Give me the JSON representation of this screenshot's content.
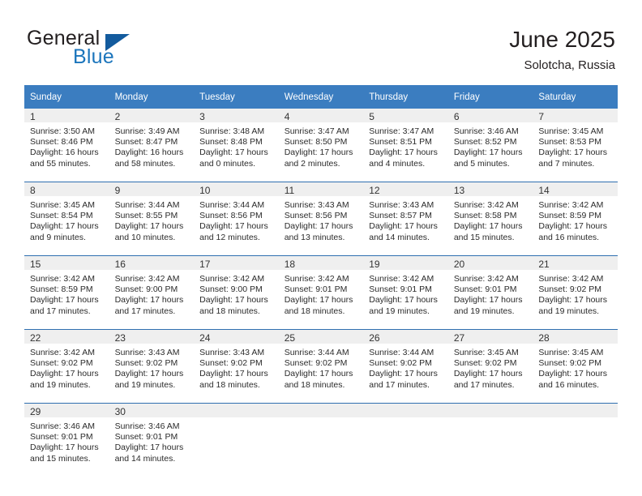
{
  "brand": {
    "name_part1": "General",
    "name_part2": "Blue",
    "triangle_icon": "triangle-logo-icon",
    "color_dark": "#231f20",
    "color_blue": "#1b75bc"
  },
  "header": {
    "title": "June 2025",
    "subtitle": "Solotcha, Russia"
  },
  "theme": {
    "header_bg": "#3b7dc0",
    "daynum_bg": "#efefef",
    "row_divider": "#2f6fb0"
  },
  "weekday_headers": [
    "Sunday",
    "Monday",
    "Tuesday",
    "Wednesday",
    "Thursday",
    "Friday",
    "Saturday"
  ],
  "weeks": [
    {
      "days": [
        {
          "num": "1",
          "sunrise": "Sunrise: 3:50 AM",
          "sunset": "Sunset: 8:46 PM",
          "daylight1": "Daylight: 16 hours",
          "daylight2": "and 55 minutes."
        },
        {
          "num": "2",
          "sunrise": "Sunrise: 3:49 AM",
          "sunset": "Sunset: 8:47 PM",
          "daylight1": "Daylight: 16 hours",
          "daylight2": "and 58 minutes."
        },
        {
          "num": "3",
          "sunrise": "Sunrise: 3:48 AM",
          "sunset": "Sunset: 8:48 PM",
          "daylight1": "Daylight: 17 hours",
          "daylight2": "and 0 minutes."
        },
        {
          "num": "4",
          "sunrise": "Sunrise: 3:47 AM",
          "sunset": "Sunset: 8:50 PM",
          "daylight1": "Daylight: 17 hours",
          "daylight2": "and 2 minutes."
        },
        {
          "num": "5",
          "sunrise": "Sunrise: 3:47 AM",
          "sunset": "Sunset: 8:51 PM",
          "daylight1": "Daylight: 17 hours",
          "daylight2": "and 4 minutes."
        },
        {
          "num": "6",
          "sunrise": "Sunrise: 3:46 AM",
          "sunset": "Sunset: 8:52 PM",
          "daylight1": "Daylight: 17 hours",
          "daylight2": "and 5 minutes."
        },
        {
          "num": "7",
          "sunrise": "Sunrise: 3:45 AM",
          "sunset": "Sunset: 8:53 PM",
          "daylight1": "Daylight: 17 hours",
          "daylight2": "and 7 minutes."
        }
      ]
    },
    {
      "days": [
        {
          "num": "8",
          "sunrise": "Sunrise: 3:45 AM",
          "sunset": "Sunset: 8:54 PM",
          "daylight1": "Daylight: 17 hours",
          "daylight2": "and 9 minutes."
        },
        {
          "num": "9",
          "sunrise": "Sunrise: 3:44 AM",
          "sunset": "Sunset: 8:55 PM",
          "daylight1": "Daylight: 17 hours",
          "daylight2": "and 10 minutes."
        },
        {
          "num": "10",
          "sunrise": "Sunrise: 3:44 AM",
          "sunset": "Sunset: 8:56 PM",
          "daylight1": "Daylight: 17 hours",
          "daylight2": "and 12 minutes."
        },
        {
          "num": "11",
          "sunrise": "Sunrise: 3:43 AM",
          "sunset": "Sunset: 8:56 PM",
          "daylight1": "Daylight: 17 hours",
          "daylight2": "and 13 minutes."
        },
        {
          "num": "12",
          "sunrise": "Sunrise: 3:43 AM",
          "sunset": "Sunset: 8:57 PM",
          "daylight1": "Daylight: 17 hours",
          "daylight2": "and 14 minutes."
        },
        {
          "num": "13",
          "sunrise": "Sunrise: 3:42 AM",
          "sunset": "Sunset: 8:58 PM",
          "daylight1": "Daylight: 17 hours",
          "daylight2": "and 15 minutes."
        },
        {
          "num": "14",
          "sunrise": "Sunrise: 3:42 AM",
          "sunset": "Sunset: 8:59 PM",
          "daylight1": "Daylight: 17 hours",
          "daylight2": "and 16 minutes."
        }
      ]
    },
    {
      "days": [
        {
          "num": "15",
          "sunrise": "Sunrise: 3:42 AM",
          "sunset": "Sunset: 8:59 PM",
          "daylight1": "Daylight: 17 hours",
          "daylight2": "and 17 minutes."
        },
        {
          "num": "16",
          "sunrise": "Sunrise: 3:42 AM",
          "sunset": "Sunset: 9:00 PM",
          "daylight1": "Daylight: 17 hours",
          "daylight2": "and 17 minutes."
        },
        {
          "num": "17",
          "sunrise": "Sunrise: 3:42 AM",
          "sunset": "Sunset: 9:00 PM",
          "daylight1": "Daylight: 17 hours",
          "daylight2": "and 18 minutes."
        },
        {
          "num": "18",
          "sunrise": "Sunrise: 3:42 AM",
          "sunset": "Sunset: 9:01 PM",
          "daylight1": "Daylight: 17 hours",
          "daylight2": "and 18 minutes."
        },
        {
          "num": "19",
          "sunrise": "Sunrise: 3:42 AM",
          "sunset": "Sunset: 9:01 PM",
          "daylight1": "Daylight: 17 hours",
          "daylight2": "and 19 minutes."
        },
        {
          "num": "20",
          "sunrise": "Sunrise: 3:42 AM",
          "sunset": "Sunset: 9:01 PM",
          "daylight1": "Daylight: 17 hours",
          "daylight2": "and 19 minutes."
        },
        {
          "num": "21",
          "sunrise": "Sunrise: 3:42 AM",
          "sunset": "Sunset: 9:02 PM",
          "daylight1": "Daylight: 17 hours",
          "daylight2": "and 19 minutes."
        }
      ]
    },
    {
      "days": [
        {
          "num": "22",
          "sunrise": "Sunrise: 3:42 AM",
          "sunset": "Sunset: 9:02 PM",
          "daylight1": "Daylight: 17 hours",
          "daylight2": "and 19 minutes."
        },
        {
          "num": "23",
          "sunrise": "Sunrise: 3:43 AM",
          "sunset": "Sunset: 9:02 PM",
          "daylight1": "Daylight: 17 hours",
          "daylight2": "and 19 minutes."
        },
        {
          "num": "24",
          "sunrise": "Sunrise: 3:43 AM",
          "sunset": "Sunset: 9:02 PM",
          "daylight1": "Daylight: 17 hours",
          "daylight2": "and 18 minutes."
        },
        {
          "num": "25",
          "sunrise": "Sunrise: 3:44 AM",
          "sunset": "Sunset: 9:02 PM",
          "daylight1": "Daylight: 17 hours",
          "daylight2": "and 18 minutes."
        },
        {
          "num": "26",
          "sunrise": "Sunrise: 3:44 AM",
          "sunset": "Sunset: 9:02 PM",
          "daylight1": "Daylight: 17 hours",
          "daylight2": "and 17 minutes."
        },
        {
          "num": "27",
          "sunrise": "Sunrise: 3:45 AM",
          "sunset": "Sunset: 9:02 PM",
          "daylight1": "Daylight: 17 hours",
          "daylight2": "and 17 minutes."
        },
        {
          "num": "28",
          "sunrise": "Sunrise: 3:45 AM",
          "sunset": "Sunset: 9:02 PM",
          "daylight1": "Daylight: 17 hours",
          "daylight2": "and 16 minutes."
        }
      ]
    },
    {
      "days": [
        {
          "num": "29",
          "sunrise": "Sunrise: 3:46 AM",
          "sunset": "Sunset: 9:01 PM",
          "daylight1": "Daylight: 17 hours",
          "daylight2": "and 15 minutes."
        },
        {
          "num": "30",
          "sunrise": "Sunrise: 3:46 AM",
          "sunset": "Sunset: 9:01 PM",
          "daylight1": "Daylight: 17 hours",
          "daylight2": "and 14 minutes."
        },
        {
          "num": "",
          "sunrise": "",
          "sunset": "",
          "daylight1": "",
          "daylight2": ""
        },
        {
          "num": "",
          "sunrise": "",
          "sunset": "",
          "daylight1": "",
          "daylight2": ""
        },
        {
          "num": "",
          "sunrise": "",
          "sunset": "",
          "daylight1": "",
          "daylight2": ""
        },
        {
          "num": "",
          "sunrise": "",
          "sunset": "",
          "daylight1": "",
          "daylight2": ""
        },
        {
          "num": "",
          "sunrise": "",
          "sunset": "",
          "daylight1": "",
          "daylight2": ""
        }
      ]
    }
  ]
}
